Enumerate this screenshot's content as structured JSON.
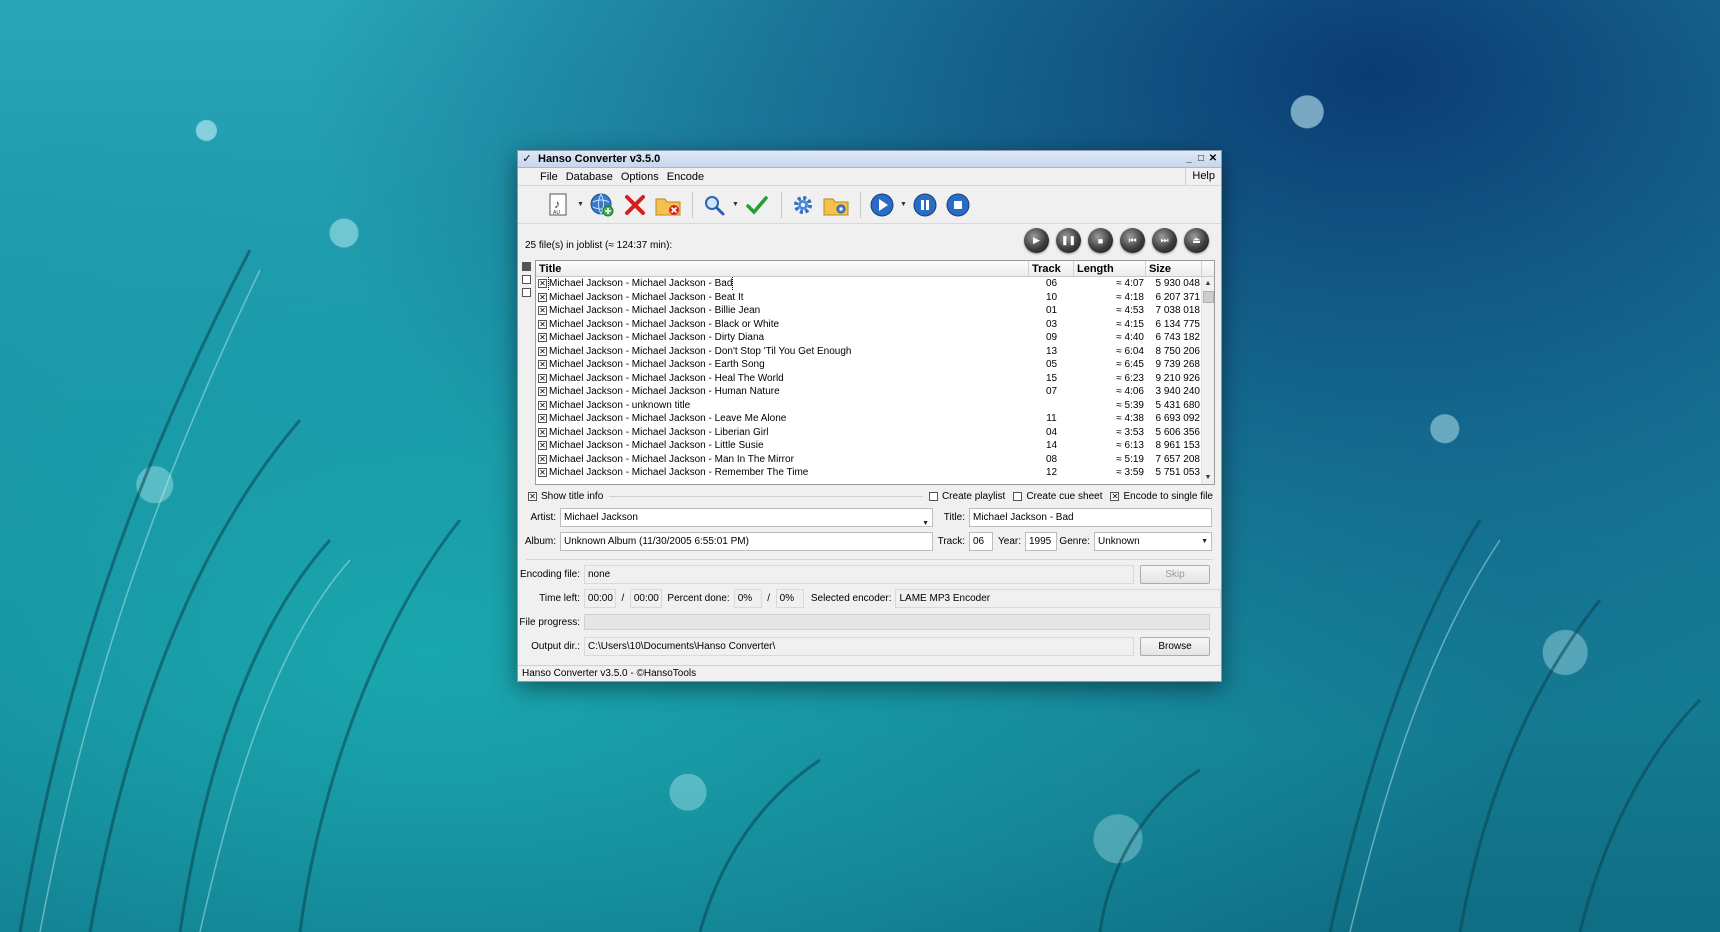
{
  "window": {
    "title": "Hanso Converter v3.5.0",
    "controls": {
      "minimize": "_",
      "restore": "□",
      "close": "✕"
    }
  },
  "menu": {
    "items": [
      "File",
      "Database",
      "Options",
      "Encode"
    ],
    "help": "Help"
  },
  "toolbar": {
    "icons": [
      "add-music-icon",
      "add-from-web-icon",
      "delete-icon",
      "remove-folder-icon",
      "search-icon",
      "check-icon",
      "settings-icon",
      "output-folder-icon",
      "play-encode-icon",
      "pause-icon",
      "stop-icon"
    ]
  },
  "joblist": {
    "summary": "25 file(s) in joblist (≈ 124:37 min):"
  },
  "columns": {
    "title": "Title",
    "track": "Track",
    "length": "Length",
    "size": "Size"
  },
  "tracks": [
    {
      "title": "Michael Jackson - Michael Jackson - Bad",
      "track": "06",
      "length": "≈ 4:07",
      "size": "5 930 048"
    },
    {
      "title": "Michael Jackson - Michael Jackson - Beat It",
      "track": "10",
      "length": "≈ 4:18",
      "size": "6 207 371"
    },
    {
      "title": "Michael Jackson - Michael Jackson - Billie Jean",
      "track": "01",
      "length": "≈ 4:53",
      "size": "7 038 018"
    },
    {
      "title": "Michael Jackson - Michael Jackson - Black or White",
      "track": "03",
      "length": "≈ 4:15",
      "size": "6 134 775"
    },
    {
      "title": "Michael Jackson - Michael Jackson - Dirty Diana",
      "track": "09",
      "length": "≈ 4:40",
      "size": "6 743 182"
    },
    {
      "title": "Michael Jackson - Michael Jackson - Don't Stop 'Til You Get Enough",
      "track": "13",
      "length": "≈ 6:04",
      "size": "8 750 206"
    },
    {
      "title": "Michael Jackson - Michael Jackson - Earth Song",
      "track": "05",
      "length": "≈ 6:45",
      "size": "9 739 268"
    },
    {
      "title": "Michael Jackson - Michael Jackson - Heal The World",
      "track": "15",
      "length": "≈ 6:23",
      "size": "9 210 926"
    },
    {
      "title": "Michael Jackson - Michael Jackson - Human Nature",
      "track": "07",
      "length": "≈ 4:06",
      "size": "3 940 240"
    },
    {
      "title": "Michael Jackson - unknown title",
      "track": "",
      "length": "≈ 5:39",
      "size": "5 431 680"
    },
    {
      "title": "Michael Jackson - Michael Jackson - Leave Me Alone",
      "track": "11",
      "length": "≈ 4:38",
      "size": "6 693 092"
    },
    {
      "title": "Michael Jackson - Michael Jackson - Liberian Girl",
      "track": "04",
      "length": "≈ 3:53",
      "size": "5 606 356"
    },
    {
      "title": "Michael Jackson - Michael Jackson - Little Susie",
      "track": "14",
      "length": "≈ 6:13",
      "size": "8 961 153"
    },
    {
      "title": "Michael Jackson - Michael Jackson - Man In The Mirror",
      "track": "08",
      "length": "≈ 5:19",
      "size": "7 657 208"
    },
    {
      "title": "Michael Jackson - Michael Jackson - Remember The Time",
      "track": "12",
      "length": "≈ 3:59",
      "size": "5 751 053"
    }
  ],
  "options": {
    "show_title_info": "Show title info",
    "create_playlist": "Create playlist",
    "create_cue_sheet": "Create cue sheet",
    "encode_single_file": "Encode to single file"
  },
  "tags": {
    "artist_label": "Artist:",
    "artist_value": "Michael Jackson",
    "title_label": "Title:",
    "title_value": "Michael Jackson - Bad",
    "album_label": "Album:",
    "album_value": "Unknown Album (11/30/2005 6:55:01 PM)",
    "track_label": "Track:",
    "track_value": "06",
    "year_label": "Year:",
    "year_value": "1995",
    "genre_label": "Genre:",
    "genre_value": "Unknown"
  },
  "encoding": {
    "encoding_file_label": "Encoding file:",
    "encoding_file_value": "none",
    "skip_button": "Skip",
    "time_left_label": "Time left:",
    "time_left_value": "00:00",
    "time_sep": "/",
    "time_total_value": "00:00",
    "percent_label": "Percent done:",
    "percent_value": "0%",
    "percent_sep": "/",
    "percent_total_value": "0%",
    "encoder_label": "Selected encoder:",
    "encoder_value": "LAME MP3 Encoder",
    "file_progress_label": "File progress:",
    "file_progress_percent": 0,
    "output_dir_label": "Output dir.:",
    "output_dir_value": "C:\\Users\\10\\Documents\\Hanso Converter\\",
    "browse_button": "Browse"
  },
  "statusbar": {
    "text": "Hanso Converter v3.5.0 - ©HansoTools"
  }
}
